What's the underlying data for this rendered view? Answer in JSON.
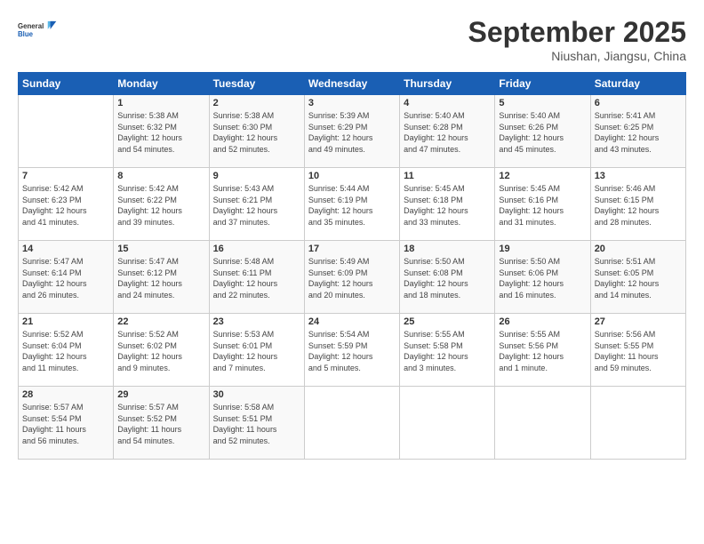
{
  "logo": {
    "line1": "General",
    "line2": "Blue"
  },
  "title": "September 2025",
  "location": "Niushan, Jiangsu, China",
  "days_header": [
    "Sunday",
    "Monday",
    "Tuesday",
    "Wednesday",
    "Thursday",
    "Friday",
    "Saturday"
  ],
  "weeks": [
    [
      {
        "day": "",
        "content": ""
      },
      {
        "day": "1",
        "content": "Sunrise: 5:38 AM\nSunset: 6:32 PM\nDaylight: 12 hours\nand 54 minutes."
      },
      {
        "day": "2",
        "content": "Sunrise: 5:38 AM\nSunset: 6:30 PM\nDaylight: 12 hours\nand 52 minutes."
      },
      {
        "day": "3",
        "content": "Sunrise: 5:39 AM\nSunset: 6:29 PM\nDaylight: 12 hours\nand 49 minutes."
      },
      {
        "day": "4",
        "content": "Sunrise: 5:40 AM\nSunset: 6:28 PM\nDaylight: 12 hours\nand 47 minutes."
      },
      {
        "day": "5",
        "content": "Sunrise: 5:40 AM\nSunset: 6:26 PM\nDaylight: 12 hours\nand 45 minutes."
      },
      {
        "day": "6",
        "content": "Sunrise: 5:41 AM\nSunset: 6:25 PM\nDaylight: 12 hours\nand 43 minutes."
      }
    ],
    [
      {
        "day": "7",
        "content": "Sunrise: 5:42 AM\nSunset: 6:23 PM\nDaylight: 12 hours\nand 41 minutes."
      },
      {
        "day": "8",
        "content": "Sunrise: 5:42 AM\nSunset: 6:22 PM\nDaylight: 12 hours\nand 39 minutes."
      },
      {
        "day": "9",
        "content": "Sunrise: 5:43 AM\nSunset: 6:21 PM\nDaylight: 12 hours\nand 37 minutes."
      },
      {
        "day": "10",
        "content": "Sunrise: 5:44 AM\nSunset: 6:19 PM\nDaylight: 12 hours\nand 35 minutes."
      },
      {
        "day": "11",
        "content": "Sunrise: 5:45 AM\nSunset: 6:18 PM\nDaylight: 12 hours\nand 33 minutes."
      },
      {
        "day": "12",
        "content": "Sunrise: 5:45 AM\nSunset: 6:16 PM\nDaylight: 12 hours\nand 31 minutes."
      },
      {
        "day": "13",
        "content": "Sunrise: 5:46 AM\nSunset: 6:15 PM\nDaylight: 12 hours\nand 28 minutes."
      }
    ],
    [
      {
        "day": "14",
        "content": "Sunrise: 5:47 AM\nSunset: 6:14 PM\nDaylight: 12 hours\nand 26 minutes."
      },
      {
        "day": "15",
        "content": "Sunrise: 5:47 AM\nSunset: 6:12 PM\nDaylight: 12 hours\nand 24 minutes."
      },
      {
        "day": "16",
        "content": "Sunrise: 5:48 AM\nSunset: 6:11 PM\nDaylight: 12 hours\nand 22 minutes."
      },
      {
        "day": "17",
        "content": "Sunrise: 5:49 AM\nSunset: 6:09 PM\nDaylight: 12 hours\nand 20 minutes."
      },
      {
        "day": "18",
        "content": "Sunrise: 5:50 AM\nSunset: 6:08 PM\nDaylight: 12 hours\nand 18 minutes."
      },
      {
        "day": "19",
        "content": "Sunrise: 5:50 AM\nSunset: 6:06 PM\nDaylight: 12 hours\nand 16 minutes."
      },
      {
        "day": "20",
        "content": "Sunrise: 5:51 AM\nSunset: 6:05 PM\nDaylight: 12 hours\nand 14 minutes."
      }
    ],
    [
      {
        "day": "21",
        "content": "Sunrise: 5:52 AM\nSunset: 6:04 PM\nDaylight: 12 hours\nand 11 minutes."
      },
      {
        "day": "22",
        "content": "Sunrise: 5:52 AM\nSunset: 6:02 PM\nDaylight: 12 hours\nand 9 minutes."
      },
      {
        "day": "23",
        "content": "Sunrise: 5:53 AM\nSunset: 6:01 PM\nDaylight: 12 hours\nand 7 minutes."
      },
      {
        "day": "24",
        "content": "Sunrise: 5:54 AM\nSunset: 5:59 PM\nDaylight: 12 hours\nand 5 minutes."
      },
      {
        "day": "25",
        "content": "Sunrise: 5:55 AM\nSunset: 5:58 PM\nDaylight: 12 hours\nand 3 minutes."
      },
      {
        "day": "26",
        "content": "Sunrise: 5:55 AM\nSunset: 5:56 PM\nDaylight: 12 hours\nand 1 minute."
      },
      {
        "day": "27",
        "content": "Sunrise: 5:56 AM\nSunset: 5:55 PM\nDaylight: 11 hours\nand 59 minutes."
      }
    ],
    [
      {
        "day": "28",
        "content": "Sunrise: 5:57 AM\nSunset: 5:54 PM\nDaylight: 11 hours\nand 56 minutes."
      },
      {
        "day": "29",
        "content": "Sunrise: 5:57 AM\nSunset: 5:52 PM\nDaylight: 11 hours\nand 54 minutes."
      },
      {
        "day": "30",
        "content": "Sunrise: 5:58 AM\nSunset: 5:51 PM\nDaylight: 11 hours\nand 52 minutes."
      },
      {
        "day": "",
        "content": ""
      },
      {
        "day": "",
        "content": ""
      },
      {
        "day": "",
        "content": ""
      },
      {
        "day": "",
        "content": ""
      }
    ]
  ]
}
